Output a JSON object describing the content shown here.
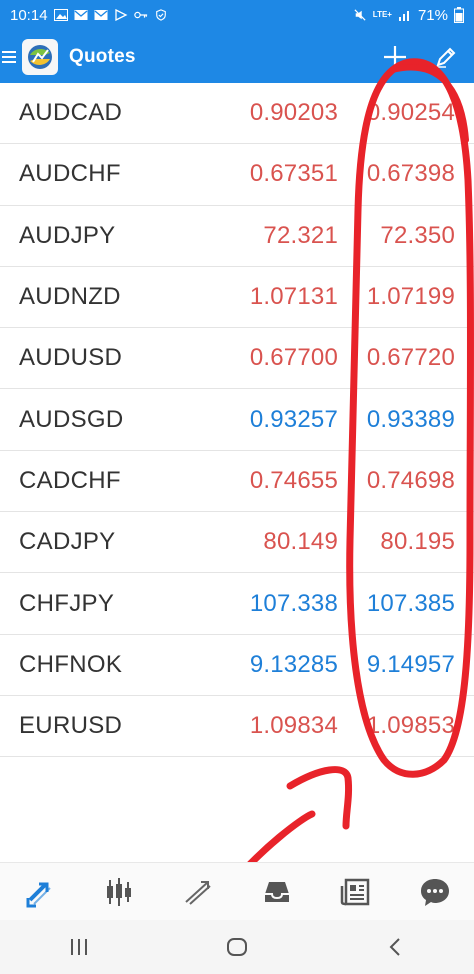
{
  "status_bar": {
    "time": "10:14",
    "network": "LTE+",
    "battery": "71%"
  },
  "app_bar": {
    "title": "Quotes"
  },
  "quotes": [
    {
      "symbol": "AUDCAD",
      "bid": "0.90203",
      "ask": "0.90254",
      "direction": "down"
    },
    {
      "symbol": "AUDCHF",
      "bid": "0.67351",
      "ask": "0.67398",
      "direction": "down"
    },
    {
      "symbol": "AUDJPY",
      "bid": "72.321",
      "ask": "72.350",
      "direction": "down"
    },
    {
      "symbol": "AUDNZD",
      "bid": "1.07131",
      "ask": "1.07199",
      "direction": "down"
    },
    {
      "symbol": "AUDUSD",
      "bid": "0.67700",
      "ask": "0.67720",
      "direction": "down"
    },
    {
      "symbol": "AUDSGD",
      "bid": "0.93257",
      "ask": "0.93389",
      "direction": "up"
    },
    {
      "symbol": "CADCHF",
      "bid": "0.74655",
      "ask": "0.74698",
      "direction": "down"
    },
    {
      "symbol": "CADJPY",
      "bid": "80.149",
      "ask": "80.195",
      "direction": "down"
    },
    {
      "symbol": "CHFJPY",
      "bid": "107.338",
      "ask": "107.385",
      "direction": "up"
    },
    {
      "symbol": "CHFNOK",
      "bid": "9.13285",
      "ask": "9.14957",
      "direction": "up"
    },
    {
      "symbol": "EURUSD",
      "bid": "1.09834",
      "ask": "1.09853",
      "direction": "down"
    }
  ],
  "colors": {
    "header_blue": "#1e88e5",
    "price_down": "#d9534f",
    "price_up": "#1e7fd8",
    "annotation_red": "#e8232a"
  },
  "bottom_nav": [
    {
      "icon": "quotes-arrows-icon",
      "active": true
    },
    {
      "icon": "chart-candles-icon",
      "active": false
    },
    {
      "icon": "trade-icon",
      "active": false
    },
    {
      "icon": "history-inbox-icon",
      "active": false
    },
    {
      "icon": "news-icon",
      "active": false
    },
    {
      "icon": "messages-chat-icon",
      "active": false
    }
  ],
  "annotations": {
    "drawn": "red hand-drawn ellipse around ask column and arrow pointing to trade tab"
  }
}
